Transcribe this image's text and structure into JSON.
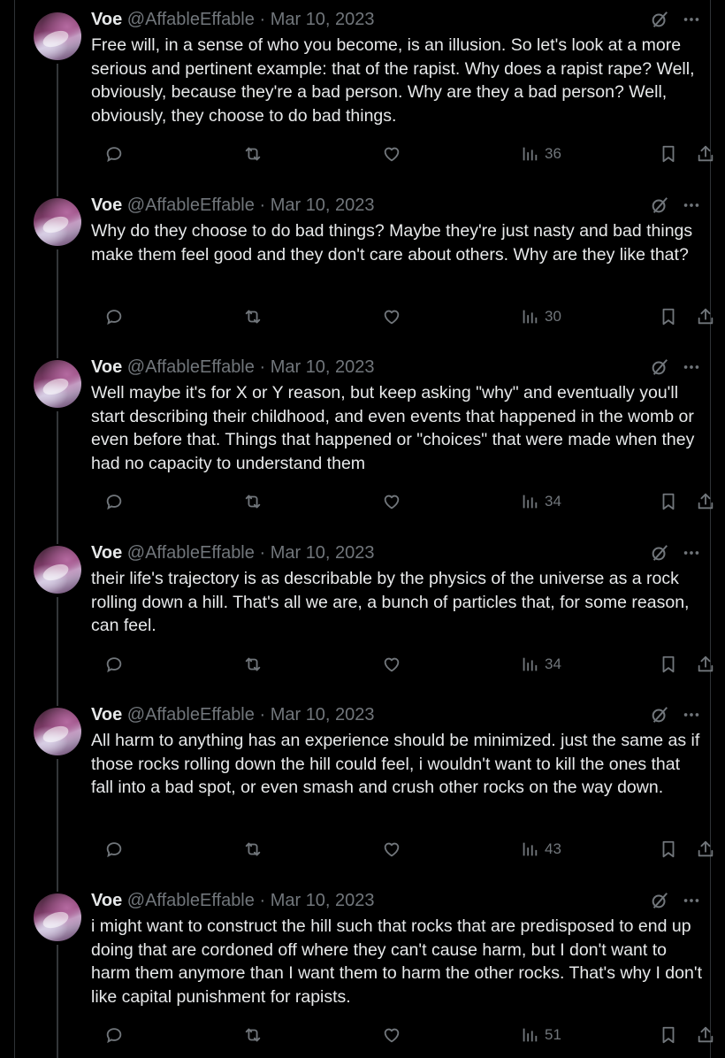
{
  "tweets": [
    {
      "name": "Voe",
      "handle": "@AffableEffable",
      "sep": "·",
      "date": "Mar 10, 2023",
      "text": "Free will, in a sense of who you become, is an illusion. So let's look at a more serious and pertinent example: that of the rapist. Why does a rapist rape? Well, obviously, because they're a bad person. Why are they a bad person? Well, obviously, they choose to do bad things.",
      "views": "36"
    },
    {
      "name": "Voe",
      "handle": "@AffableEffable",
      "sep": "·",
      "date": "Mar 10, 2023",
      "text": "Why do they choose to do bad things? Maybe they're just nasty and bad things make them feel good and they don't care about others. Why are they like that?",
      "views": "30"
    },
    {
      "name": "Voe",
      "handle": "@AffableEffable",
      "sep": "·",
      "date": "Mar 10, 2023",
      "text": "Well maybe it's for X or Y reason, but keep asking \"why\" and eventually you'll start describing their childhood, and even events that happened in the womb or even before that. Things that happened or \"choices\" that were made when they had no capacity to understand them",
      "views": "34"
    },
    {
      "name": "Voe",
      "handle": "@AffableEffable",
      "sep": "·",
      "date": "Mar 10, 2023",
      "text": "their life's trajectory is as describable by the physics of the universe as a rock rolling down a hill. That's all we are, a bunch of particles that, for some reason, can feel.",
      "views": "34"
    },
    {
      "name": "Voe",
      "handle": "@AffableEffable",
      "sep": "·",
      "date": "Mar 10, 2023",
      "text": "All harm to anything has an experience should be minimized. just the same as if those rocks rolling down the hill could feel, i wouldn't want to kill the ones that fall into a bad spot, or even smash and crush other rocks on the way down.",
      "views": "43"
    },
    {
      "name": "Voe",
      "handle": "@AffableEffable",
      "sep": "·",
      "date": "Mar 10, 2023",
      "text": "i might want to construct the hill such that rocks that are predisposed to end up doing that are cordoned off where they can't cause harm, but I don't want to harm them anymore than I want them to harm the other rocks. That's why I don't like capital punishment for rapists.",
      "views": "51"
    }
  ],
  "icons": {
    "reply": "reply-icon",
    "repost": "repost-icon",
    "like": "like-icon",
    "views": "views-icon",
    "bookmark": "bookmark-icon",
    "share": "share-icon",
    "grok": "grok-icon",
    "more": "more-icon"
  },
  "colors": {
    "background": "#000000",
    "text": "#e7e9ea",
    "muted": "#71767b",
    "rail": "#333639"
  }
}
